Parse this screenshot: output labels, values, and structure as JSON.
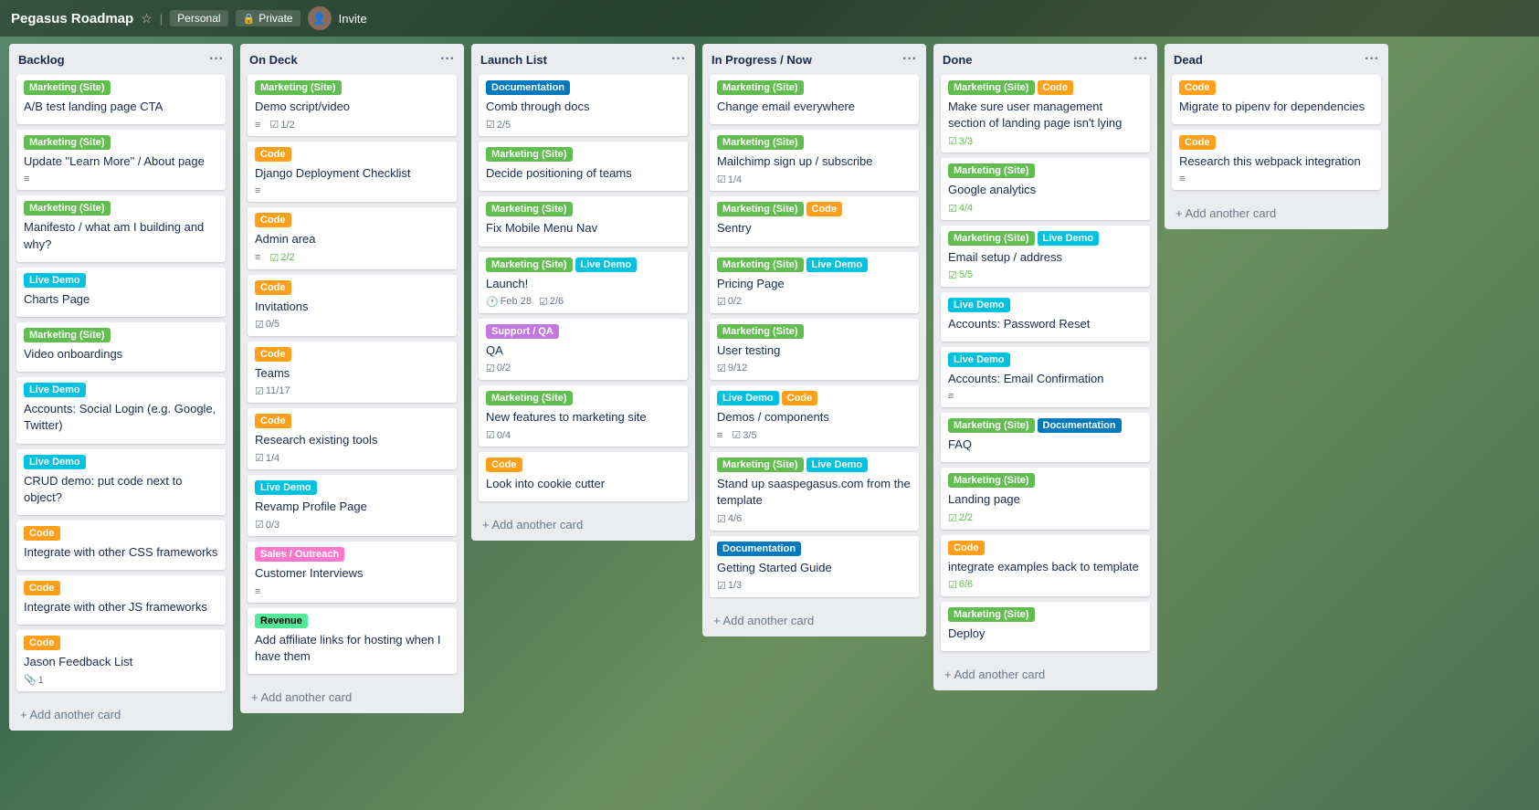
{
  "header": {
    "title": "Pegasus Roadmap",
    "personal_label": "Personal",
    "private_label": "Private",
    "invite_label": "Invite"
  },
  "columns": [
    {
      "id": "backlog",
      "title": "Backlog",
      "cards": [
        {
          "labels": [
            {
              "text": "Marketing (Site)",
              "type": "marketing"
            }
          ],
          "title": "A/B test landing page CTA",
          "meta": []
        },
        {
          "labels": [
            {
              "text": "Marketing (Site)",
              "type": "marketing"
            }
          ],
          "title": "Update \"Learn More\" / About page",
          "meta": [
            {
              "icon": "≡",
              "text": ""
            }
          ]
        },
        {
          "labels": [
            {
              "text": "Marketing (Site)",
              "type": "marketing"
            }
          ],
          "title": "Manifesto / what am I building and why?",
          "meta": []
        },
        {
          "labels": [
            {
              "text": "Live Demo",
              "type": "livedemo"
            }
          ],
          "title": "Charts Page",
          "meta": []
        },
        {
          "labels": [
            {
              "text": "Marketing (Site)",
              "type": "marketing"
            }
          ],
          "title": "Video onboardings",
          "meta": []
        },
        {
          "labels": [
            {
              "text": "Live Demo",
              "type": "livedemo"
            }
          ],
          "title": "Accounts: Social Login (e.g. Google, Twitter)",
          "meta": []
        },
        {
          "labels": [
            {
              "text": "Live Demo",
              "type": "livedemo"
            }
          ],
          "title": "CRUD demo: put code next to object?",
          "meta": []
        },
        {
          "labels": [
            {
              "text": "Code",
              "type": "code"
            }
          ],
          "title": "Integrate with other CSS frameworks",
          "meta": []
        },
        {
          "labels": [
            {
              "text": "Code",
              "type": "code"
            }
          ],
          "title": "Integrate with other JS frameworks",
          "meta": []
        },
        {
          "labels": [
            {
              "text": "Code",
              "type": "code"
            }
          ],
          "title": "Jason Feedback List",
          "meta": [
            {
              "icon": "📎",
              "text": "1"
            }
          ]
        }
      ],
      "add_label": "+ Add another card"
    },
    {
      "id": "on-deck",
      "title": "On Deck",
      "cards": [
        {
          "labels": [
            {
              "text": "Marketing (Site)",
              "type": "marketing"
            }
          ],
          "title": "Demo script/video",
          "meta": [
            {
              "icon": "≡",
              "text": ""
            },
            {
              "icon": "☑",
              "text": "1/2"
            }
          ]
        },
        {
          "labels": [
            {
              "text": "Code",
              "type": "code"
            }
          ],
          "title": "Django Deployment Checklist",
          "meta": [
            {
              "icon": "≡",
              "text": ""
            }
          ]
        },
        {
          "labels": [
            {
              "text": "Code",
              "type": "code"
            }
          ],
          "title": "Admin area",
          "meta": [
            {
              "icon": "≡",
              "text": ""
            },
            {
              "icon": "☑",
              "text": "2/2",
              "done": true
            }
          ]
        },
        {
          "labels": [
            {
              "text": "Code",
              "type": "code"
            }
          ],
          "title": "Invitations",
          "meta": [
            {
              "icon": "☑",
              "text": "0/5"
            }
          ]
        },
        {
          "labels": [
            {
              "text": "Code",
              "type": "code"
            }
          ],
          "title": "Teams",
          "meta": [
            {
              "icon": "☑",
              "text": "11/17"
            }
          ]
        },
        {
          "labels": [
            {
              "text": "Code",
              "type": "code"
            }
          ],
          "title": "Research existing tools",
          "meta": [
            {
              "icon": "☑",
              "text": "1/4"
            }
          ]
        },
        {
          "labels": [
            {
              "text": "Live Demo",
              "type": "livedemo"
            }
          ],
          "title": "Revamp Profile Page",
          "meta": [
            {
              "icon": "☑",
              "text": "0/3"
            }
          ]
        },
        {
          "labels": [
            {
              "text": "Sales / Outreach",
              "type": "sales"
            }
          ],
          "title": "Customer Interviews",
          "meta": [
            {
              "icon": "≡",
              "text": ""
            }
          ]
        },
        {
          "labels": [
            {
              "text": "Revenue",
              "type": "revenue"
            }
          ],
          "title": "Add affiliate links for hosting when I have them",
          "meta": []
        }
      ],
      "add_label": "+ Add another card"
    },
    {
      "id": "launch-list",
      "title": "Launch List",
      "cards": [
        {
          "labels": [
            {
              "text": "Documentation",
              "type": "documentation"
            }
          ],
          "title": "Comb through docs",
          "meta": [
            {
              "icon": "☑",
              "text": "2/5"
            }
          ]
        },
        {
          "labels": [
            {
              "text": "Marketing (Site)",
              "type": "marketing"
            }
          ],
          "title": "Decide positioning of teams",
          "meta": []
        },
        {
          "labels": [
            {
              "text": "Marketing (Site)",
              "type": "marketing"
            }
          ],
          "title": "Fix Mobile Menu Nav",
          "meta": []
        },
        {
          "labels": [
            {
              "text": "Marketing (Site)",
              "type": "marketing"
            },
            {
              "text": "Live Demo",
              "type": "livedemo"
            }
          ],
          "title": "Launch!",
          "meta": [
            {
              "icon": "🕐",
              "text": "Feb 28"
            },
            {
              "icon": "☑",
              "text": "2/6"
            }
          ]
        },
        {
          "labels": [
            {
              "text": "Support / QA",
              "type": "support"
            }
          ],
          "title": "QA",
          "meta": [
            {
              "icon": "☑",
              "text": "0/2"
            }
          ]
        },
        {
          "labels": [
            {
              "text": "Marketing (Site)",
              "type": "marketing"
            }
          ],
          "title": "New features to marketing site",
          "meta": [
            {
              "icon": "☑",
              "text": "0/4"
            }
          ]
        },
        {
          "labels": [
            {
              "text": "Code",
              "type": "code"
            }
          ],
          "title": "Look into cookie cutter",
          "meta": []
        }
      ],
      "add_label": "+ Add another card"
    },
    {
      "id": "in-progress",
      "title": "In Progress / Now",
      "cards": [
        {
          "labels": [
            {
              "text": "Marketing (Site)",
              "type": "marketing"
            }
          ],
          "title": "Change email everywhere",
          "meta": []
        },
        {
          "labels": [
            {
              "text": "Marketing (Site)",
              "type": "marketing"
            }
          ],
          "title": "Mailchimp sign up / subscribe",
          "meta": [
            {
              "icon": "☑",
              "text": "1/4"
            }
          ]
        },
        {
          "labels": [
            {
              "text": "Marketing (Site)",
              "type": "marketing"
            },
            {
              "text": "Code",
              "type": "code"
            }
          ],
          "title": "Sentry",
          "meta": []
        },
        {
          "labels": [
            {
              "text": "Marketing (Site)",
              "type": "marketing"
            },
            {
              "text": "Live Demo",
              "type": "livedemo"
            }
          ],
          "title": "Pricing Page",
          "meta": [
            {
              "icon": "☑",
              "text": "0/2"
            }
          ]
        },
        {
          "labels": [
            {
              "text": "Marketing (Site)",
              "type": "marketing"
            }
          ],
          "title": "User testing",
          "meta": [
            {
              "icon": "☑",
              "text": "9/12"
            }
          ]
        },
        {
          "labels": [
            {
              "text": "Live Demo",
              "type": "livedemo"
            },
            {
              "text": "Code",
              "type": "code"
            }
          ],
          "title": "Demos / components",
          "meta": [
            {
              "icon": "≡",
              "text": ""
            },
            {
              "icon": "☑",
              "text": "3/5"
            }
          ]
        },
        {
          "labels": [
            {
              "text": "Marketing (Site)",
              "type": "marketing"
            },
            {
              "text": "Live Demo",
              "type": "livedemo"
            }
          ],
          "title": "Stand up saaspegasus.com from the template",
          "meta": [
            {
              "icon": "☑",
              "text": "4/6"
            }
          ]
        },
        {
          "labels": [
            {
              "text": "Documentation",
              "type": "documentation"
            }
          ],
          "title": "Getting Started Guide",
          "meta": [
            {
              "icon": "☑",
              "text": "1/3"
            }
          ]
        }
      ],
      "add_label": "+ Add another card"
    },
    {
      "id": "done",
      "title": "Done",
      "cards": [
        {
          "labels": [
            {
              "text": "Marketing (Site)",
              "type": "marketing"
            },
            {
              "text": "Code",
              "type": "code"
            }
          ],
          "title": "Make sure user management section of landing page isn't lying",
          "meta": [
            {
              "icon": "☑",
              "text": "3/3",
              "done": true
            }
          ]
        },
        {
          "labels": [
            {
              "text": "Marketing (Site)",
              "type": "marketing"
            }
          ],
          "title": "Google analytics",
          "meta": [
            {
              "icon": "☑",
              "text": "4/4",
              "done": true
            }
          ]
        },
        {
          "labels": [
            {
              "text": "Marketing (Site)",
              "type": "marketing"
            },
            {
              "text": "Live Demo",
              "type": "livedemo"
            }
          ],
          "title": "Email setup / address",
          "meta": [
            {
              "icon": "☑",
              "text": "5/5",
              "done": true
            }
          ]
        },
        {
          "labels": [
            {
              "text": "Live Demo",
              "type": "livedemo"
            }
          ],
          "title": "Accounts: Password Reset",
          "meta": []
        },
        {
          "labels": [
            {
              "text": "Live Demo",
              "type": "livedemo"
            }
          ],
          "title": "Accounts: Email Confirmation",
          "meta": [
            {
              "icon": "≡",
              "text": ""
            }
          ]
        },
        {
          "labels": [
            {
              "text": "Marketing (Site)",
              "type": "marketing"
            },
            {
              "text": "Documentation",
              "type": "documentation"
            }
          ],
          "title": "FAQ",
          "meta": []
        },
        {
          "labels": [
            {
              "text": "Marketing (Site)",
              "type": "marketing"
            }
          ],
          "title": "Landing page",
          "meta": [
            {
              "icon": "☑",
              "text": "2/2",
              "done": true
            }
          ]
        },
        {
          "labels": [
            {
              "text": "Code",
              "type": "code"
            }
          ],
          "title": "integrate examples back to template",
          "meta": [
            {
              "icon": "☑",
              "text": "6/6",
              "done": true
            }
          ]
        },
        {
          "labels": [
            {
              "text": "Marketing (Site)",
              "type": "marketing"
            }
          ],
          "title": "Deploy",
          "meta": []
        }
      ],
      "add_label": "+ Add another card"
    },
    {
      "id": "dead",
      "title": "Dead",
      "cards": [
        {
          "labels": [
            {
              "text": "Code",
              "type": "code"
            }
          ],
          "title": "Migrate to pipenv for dependencies",
          "meta": []
        },
        {
          "labels": [
            {
              "text": "Code",
              "type": "code"
            }
          ],
          "title": "Research this webpack integration",
          "meta": [
            {
              "icon": "≡",
              "text": ""
            }
          ]
        }
      ],
      "add_label": "+ Add another card"
    }
  ]
}
